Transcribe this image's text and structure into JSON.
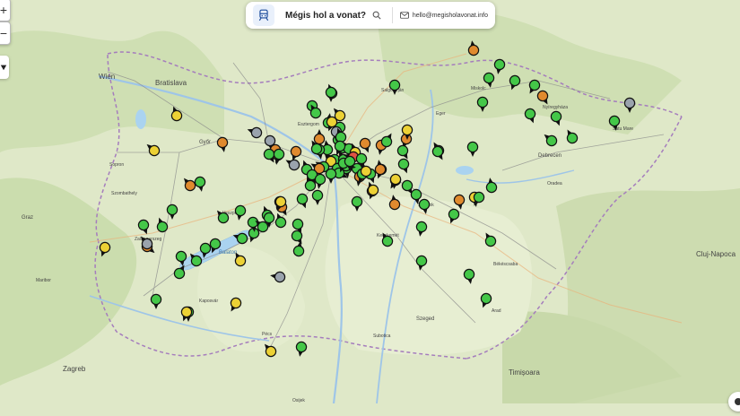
{
  "app": {
    "title": "Mégis hol a vonat?",
    "email": "hello@megisholavonat.info"
  },
  "icons": {
    "brand": "train-icon",
    "search": "search-icon",
    "mail": "mail-icon",
    "zoom_in": "plus-icon",
    "zoom_out": "minus-icon",
    "locate": "locate-icon",
    "info": "info-icon"
  },
  "colors": {
    "on_time": "#44c748",
    "slight_delay": "#ecd135",
    "delayed": "#e08a2e",
    "heavy_delay": "#e05343",
    "unknown": "#9aa3ad",
    "brand_bg": "#e9f0fb",
    "brand_icon": "#1f4e9c"
  },
  "map": {
    "labels": [
      "Wien",
      "Bratislava",
      "Győr",
      "Balaton",
      "Szeged",
      "Debrecen",
      "Salgótarján",
      "Miskolc",
      "Nyíregyháza",
      "Eger",
      "Oradea",
      "Cluj-Napoca",
      "Timișoara",
      "Zagreb",
      "Graz",
      "Maribor",
      "Subotica",
      "Arad",
      "Kecskemét",
      "Szombathely",
      "Veszprém",
      "Pécs",
      "Kaposvár",
      "Zalaegerszeg",
      "Sopron",
      "Satu Mare",
      "Békéscsaba",
      "Szolnok",
      "Esztergom",
      "Osijek"
    ],
    "markers": [
      {
        "s": "on_time",
        "a": -20
      },
      {
        "s": "on_time",
        "a": 170
      },
      {
        "s": "on_time",
        "a": 10
      },
      {
        "s": "on_time",
        "a": 170
      },
      {
        "s": "on_time",
        "a": -30
      },
      {
        "s": "delayed",
        "a": 0
      },
      {
        "s": "on_time",
        "a": 180
      },
      {
        "s": "on_time",
        "a": -10
      },
      {
        "s": "on_time",
        "a": 200
      },
      {
        "s": "on_time",
        "a": 170
      },
      {
        "s": "delayed",
        "a": 160
      },
      {
        "s": "delayed",
        "a": 190
      },
      {
        "s": "on_time",
        "a": 30
      },
      {
        "s": "slight_delay",
        "a": -20
      },
      {
        "s": "on_time",
        "a": 170
      },
      {
        "s": "on_time",
        "a": -60
      },
      {
        "s": "slight_delay",
        "a": -40
      },
      {
        "s": "on_time",
        "a": 200
      },
      {
        "s": "heavy_delay",
        "a": -80
      },
      {
        "s": "on_time",
        "a": -60
      },
      {
        "s": "delayed",
        "a": -60
      },
      {
        "s": "unknown",
        "a": -60
      },
      {
        "s": "unknown",
        "a": 170
      },
      {
        "s": "delayed",
        "a": 190
      },
      {
        "s": "slight_delay",
        "a": 190
      },
      {
        "s": "unknown",
        "a": -70
      },
      {
        "s": "on_time",
        "a": 150
      },
      {
        "s": "on_time",
        "a": -20
      },
      {
        "s": "on_time",
        "a": 180
      },
      {
        "s": "on_time",
        "a": 170
      },
      {
        "s": "on_time",
        "a": 180
      },
      {
        "s": "on_time",
        "a": 170
      },
      {
        "s": "on_time",
        "a": 100
      },
      {
        "s": "on_time",
        "a": 120
      },
      {
        "s": "delayed",
        "a": 190
      },
      {
        "s": "on_time",
        "a": 180
      },
      {
        "s": "on_time",
        "a": 160
      },
      {
        "s": "on_time",
        "a": 190
      },
      {
        "s": "on_time",
        "a": -20
      },
      {
        "s": "delayed",
        "a": -20
      },
      {
        "s": "on_time",
        "a": 200
      },
      {
        "s": "on_time",
        "a": 160
      },
      {
        "s": "delayed",
        "a": 210
      },
      {
        "s": "slight_delay",
        "a": 200
      },
      {
        "s": "delayed",
        "a": 200
      },
      {
        "s": "on_time",
        "a": 150
      },
      {
        "s": "on_time",
        "a": 160
      },
      {
        "s": "on_time",
        "a": 180
      },
      {
        "s": "on_time",
        "a": 180
      },
      {
        "s": "on_time",
        "a": 150
      },
      {
        "s": "on_time",
        "a": 170
      },
      {
        "s": "delayed",
        "a": -10
      },
      {
        "s": "on_time",
        "a": 170
      },
      {
        "s": "on_time",
        "a": -30
      },
      {
        "s": "on_time",
        "a": 150
      },
      {
        "s": "slight_delay",
        "a": 180
      },
      {
        "s": "on_time",
        "a": 200
      },
      {
        "s": "delayed",
        "a": 170
      },
      {
        "s": "on_time",
        "a": 180
      },
      {
        "s": "delayed",
        "a": 150
      },
      {
        "s": "on_time",
        "a": 210
      },
      {
        "s": "on_time",
        "a": -30
      },
      {
        "s": "on_time",
        "a": -50
      },
      {
        "s": "on_time",
        "a": 160
      },
      {
        "s": "on_time",
        "a": 160
      },
      {
        "s": "on_time",
        "a": 170
      },
      {
        "s": "unknown",
        "a": 180
      },
      {
        "s": "on_time",
        "a": 200
      },
      {
        "s": "on_time",
        "a": 190
      },
      {
        "s": "on_time",
        "a": 170
      },
      {
        "s": "delayed",
        "a": -10
      },
      {
        "s": "on_time",
        "a": 180
      },
      {
        "s": "on_time",
        "a": -10
      },
      {
        "s": "slight_delay",
        "a": 170
      },
      {
        "s": "on_time",
        "a": 210
      },
      {
        "s": "on_time",
        "a": -30
      },
      {
        "s": "on_time",
        "a": 170
      },
      {
        "s": "on_time",
        "a": 200
      },
      {
        "s": "on_time",
        "a": 190
      },
      {
        "s": "on_time",
        "a": 190
      },
      {
        "s": "on_time",
        "a": -30
      },
      {
        "s": "on_time",
        "a": 180
      },
      {
        "s": "delayed",
        "a": 150
      },
      {
        "s": "delayed",
        "a": 150
      },
      {
        "s": "on_time",
        "a": -20
      },
      {
        "s": "on_time",
        "a": 160
      },
      {
        "s": "on_time",
        "a": 150
      },
      {
        "s": "on_time",
        "a": 10
      },
      {
        "s": "on_time",
        "a": -20
      },
      {
        "s": "on_time",
        "a": 200
      },
      {
        "s": "on_time",
        "a": 190
      },
      {
        "s": "on_time",
        "a": 170
      },
      {
        "s": "on_time",
        "a": -70
      },
      {
        "s": "on_time",
        "a": -40
      },
      {
        "s": "slight_delay",
        "a": -30
      },
      {
        "s": "on_time",
        "a": 200
      },
      {
        "s": "on_time",
        "a": 190
      },
      {
        "s": "delayed",
        "a": 170
      },
      {
        "s": "on_time",
        "a": 180
      },
      {
        "s": "on_time",
        "a": -20
      },
      {
        "s": "on_time",
        "a": 160
      },
      {
        "s": "delayed",
        "a": 130
      },
      {
        "s": "delayed",
        "a": -40
      },
      {
        "s": "on_time",
        "a": 170
      },
      {
        "s": "slight_delay",
        "a": -20
      },
      {
        "s": "slight_delay",
        "a": -50
      },
      {
        "s": "slight_delay",
        "a": 200
      },
      {
        "s": "unknown",
        "a": -40
      },
      {
        "s": "on_time",
        "a": 30
      },
      {
        "s": "on_time",
        "a": 170
      },
      {
        "s": "on_time",
        "a": -40
      },
      {
        "s": "on_time",
        "a": 180
      },
      {
        "s": "on_time",
        "a": 180
      },
      {
        "s": "slight_delay",
        "a": 200
      },
      {
        "s": "slight_delay",
        "a": 210
      },
      {
        "s": "slight_delay",
        "a": -40
      },
      {
        "s": "on_time",
        "a": 190
      },
      {
        "s": "unknown",
        "a": -80
      },
      {
        "s": "on_time",
        "a": 180
      },
      {
        "s": "on_time",
        "a": -50
      },
      {
        "s": "slight_delay",
        "a": 200
      },
      {
        "s": "slight_delay",
        "a": -30
      },
      {
        "s": "slight_delay",
        "a": 200
      },
      {
        "s": "slight_delay",
        "a": 190
      },
      {
        "s": "delayed",
        "a": -10
      },
      {
        "s": "delayed",
        "a": 200
      },
      {
        "s": "on_time",
        "a": 200
      },
      {
        "s": "on_time",
        "a": 180
      },
      {
        "s": "slight_delay",
        "a": 200
      },
      {
        "s": "on_time",
        "a": -30
      },
      {
        "s": "slight_delay",
        "a": -40
      },
      {
        "s": "unknown",
        "a": 180
      },
      {
        "s": "on_time",
        "a": -20
      },
      {
        "s": "on_time",
        "a": 200
      },
      {
        "s": "on_time",
        "a": 200
      },
      {
        "s": "on_time",
        "a": 180
      },
      {
        "s": "on_time",
        "a": 160
      },
      {
        "s": "on_time",
        "a": -10
      },
      {
        "s": "on_time",
        "a": -40
      },
      {
        "s": "on_time",
        "a": 180
      },
      {
        "s": "slight_delay",
        "a": 190
      },
      {
        "s": "on_time",
        "a": 190
      },
      {
        "s": "on_time",
        "a": 200
      }
    ]
  }
}
